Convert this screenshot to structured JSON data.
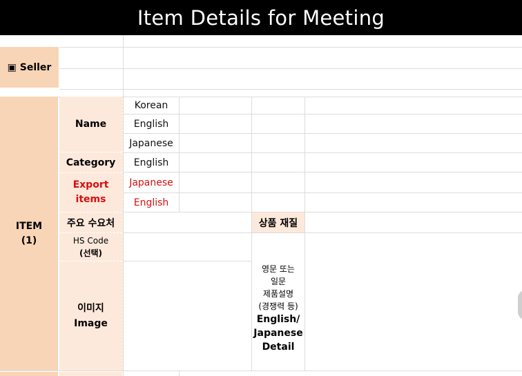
{
  "title": "Item Details for Meeting",
  "seller": {
    "label": "▣ Seller"
  },
  "item": {
    "label_line1": "ITEM",
    "label_line2": "(1)",
    "name_label": "Name",
    "category_label": "Category",
    "export_label_line1": "Export",
    "export_label_line2": "items",
    "buyers_label": "주요 수요처",
    "hs_label_line1": "HS Code",
    "hs_label_line2": "(선택)",
    "image_label_line1": "이미지",
    "image_label_line2": "Image",
    "material_label": "상품 재질",
    "name_langs": [
      "Korean",
      "English",
      "Japanese"
    ],
    "category_lang": "English",
    "export_langs": [
      "Japanese",
      "English"
    ],
    "detail_note_lines": [
      "영문 또는",
      "일문",
      "제품설명",
      "(경쟁력 등)"
    ],
    "detail_bold_lines": [
      "English/",
      "Japanese",
      "Detail"
    ]
  },
  "colors": {
    "title_bg": "#000000",
    "label_dark": "#f8d5b6",
    "label_light": "#fde9db",
    "grid": "#dcdcdc",
    "accent_red": "#d90e0e"
  }
}
